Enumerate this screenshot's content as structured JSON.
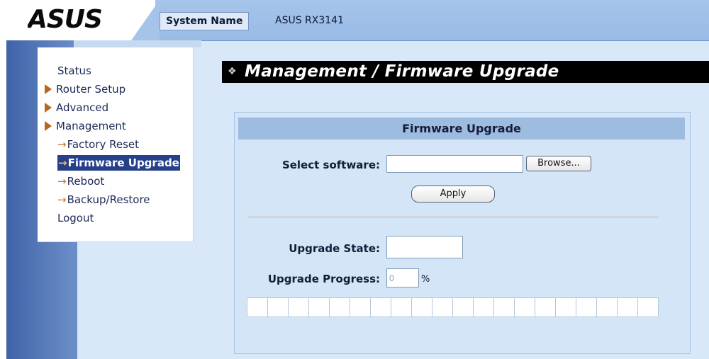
{
  "header": {
    "logo_text": "ASUS",
    "system_name_label": "System Name",
    "system_name_value": "ASUS RX3141"
  },
  "menu": {
    "items": [
      {
        "label": "Status",
        "style": "plain"
      },
      {
        "label": "Router Setup",
        "style": "caret"
      },
      {
        "label": "Advanced",
        "style": "caret"
      },
      {
        "label": "Management",
        "style": "caret"
      },
      {
        "label": "Factory Reset",
        "style": "sub"
      },
      {
        "label": "Firmware Upgrade",
        "style": "sub-active"
      },
      {
        "label": "Reboot",
        "style": "sub"
      },
      {
        "label": "Backup/Restore",
        "style": "sub"
      },
      {
        "label": "Logout",
        "style": "plain"
      }
    ]
  },
  "page": {
    "title": "Management / Firmware Upgrade"
  },
  "panel": {
    "header": "Firmware Upgrade",
    "select_software_label": "Select software:",
    "select_software_value": "",
    "browse_label": "Browse...",
    "apply_label": "Apply",
    "upgrade_state_label": "Upgrade State:",
    "upgrade_state_value": "",
    "upgrade_progress_label": "Upgrade Progress:",
    "upgrade_progress_value": "0",
    "percent_sign": "%",
    "progress_cells": 20,
    "progress_fraction": 0
  },
  "colors": {
    "header_bg": "#a6c4e9",
    "title_bg": "#000000",
    "active_menu_bg": "#26418a",
    "caret": "#b8661c"
  }
}
